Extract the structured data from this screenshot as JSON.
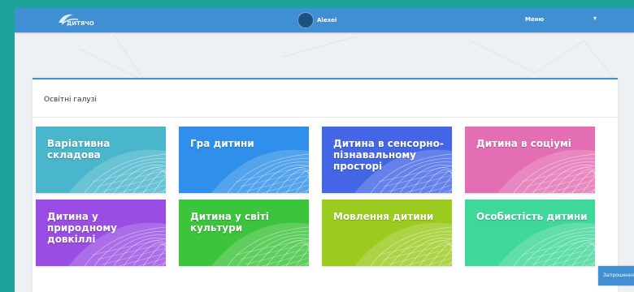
{
  "header": {
    "logo_text": "ДИТЯЧО",
    "user_name": "Alexei",
    "menu_label": "Меню",
    "caret": "▾"
  },
  "panel": {
    "title": "Освітні галузі"
  },
  "tiles": [
    {
      "label": "Варіативна складова",
      "color": "#4ab6cc"
    },
    {
      "label": "Гра дитини",
      "color": "#2f8fea"
    },
    {
      "label": "Дитина в сенсорно-пізнавальному просторі",
      "color": "#4466e6"
    },
    {
      "label": "Дитина в соціумі",
      "color": "#e46eb3"
    },
    {
      "label": "Дитина у природному довкіллі",
      "color": "#9a4de3"
    },
    {
      "label": "Дитина у світі культури",
      "color": "#3cc43c"
    },
    {
      "label": "Мовлення дитини",
      "color": "#9ccb1f"
    },
    {
      "label": "Особистість дитини",
      "color": "#3fd79a"
    }
  ],
  "side_button": {
    "label": "Запрошення"
  }
}
